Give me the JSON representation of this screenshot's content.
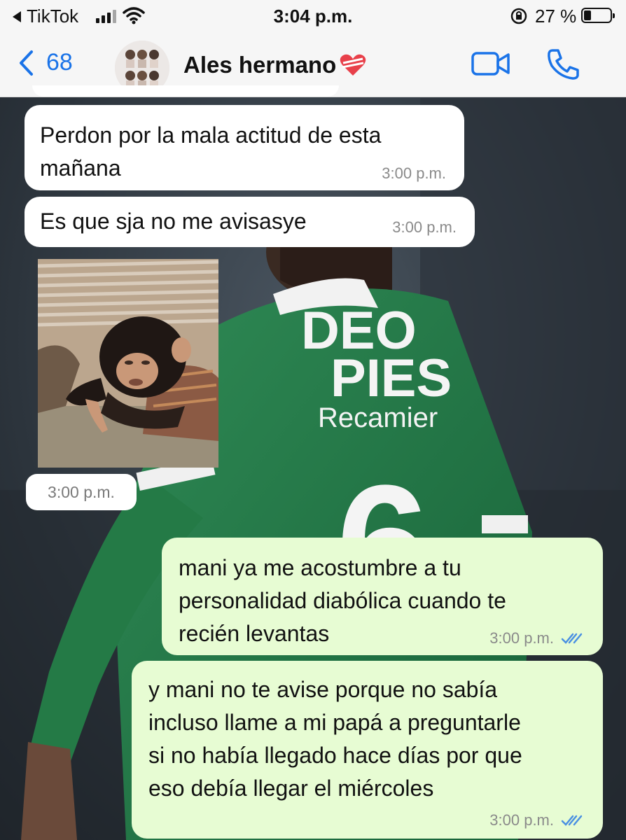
{
  "status_bar": {
    "back_app": "TikTok",
    "time": "3:04 p.m.",
    "battery": "27 %"
  },
  "header": {
    "back_count": "68",
    "contact_name": "Ales hermano",
    "name_emoji": "heart-with-ribbon",
    "accent_color": "#1a73e8"
  },
  "wallpaper": {
    "jersey_line1": "DEO",
    "jersey_line2": "PIES",
    "jersey_line3": "Recamier",
    "jersey_number": "6"
  },
  "messages": [
    {
      "direction": "in",
      "text": "Perdon por la mala actitud de esta\nmañana",
      "time": "3:00 p.m."
    },
    {
      "direction": "in",
      "text": "Es que sja no me avisasye",
      "time": "3:00 p.m."
    },
    {
      "direction": "in",
      "type": "image",
      "image": "chimp-pointing-down",
      "time": "3:00 p.m."
    },
    {
      "direction": "out",
      "text": "mani ya me acostumbre a tu\npersonalidad diabólica cuando te\nrecién levantas",
      "time": "3:00 p.m.",
      "status": "read"
    },
    {
      "direction": "out",
      "text": "y mani no te avise porque no sabía\nincluso llame a mi papá a preguntarle\nsi no había llegado hace días por que\neso debía llegar el miércoles",
      "time": "3:00 p.m.",
      "status": "read"
    }
  ],
  "colors": {
    "incoming_bubble": "#ffffff",
    "outgoing_bubble": "#e7fcd3",
    "read_ticks": "#4a90e2"
  }
}
